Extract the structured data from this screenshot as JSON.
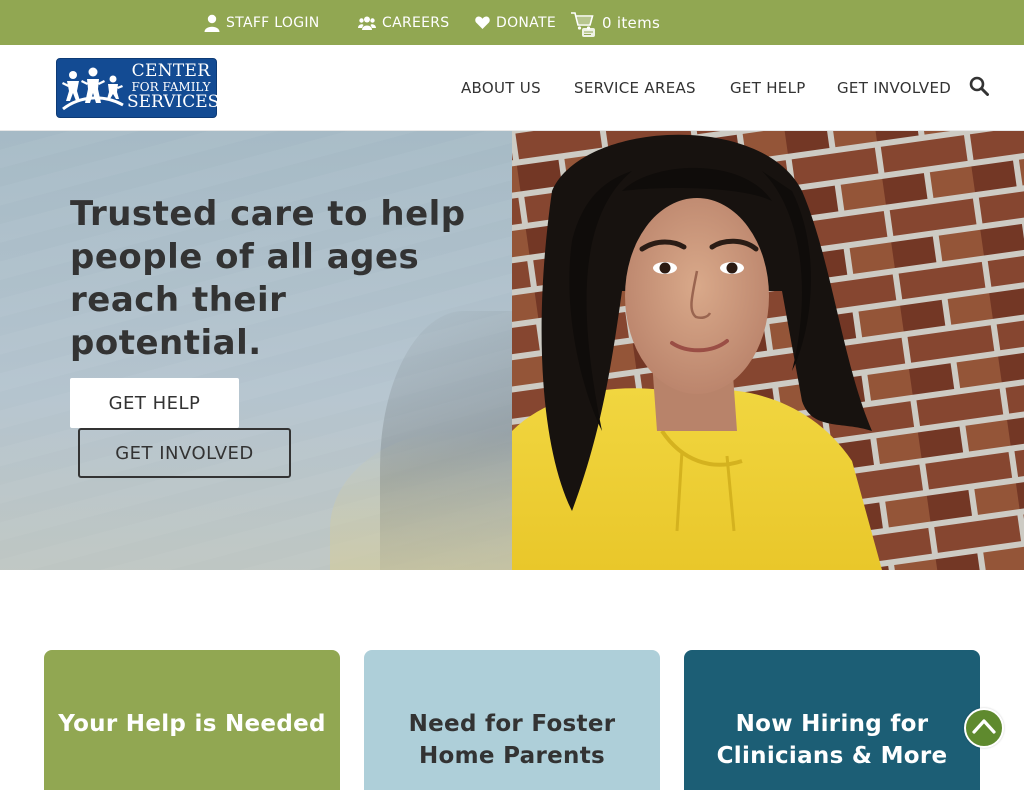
{
  "topbar": {
    "staff_login": "STAFF LOGIN",
    "careers": "CAREERS",
    "donate": "DONATE",
    "cart_items": "0 items",
    "icons": [
      "user-icon",
      "group-icon",
      "heart-icon",
      "cart-icon"
    ]
  },
  "logo": {
    "line1": "CENTER",
    "line2": "FOR FAMILY",
    "line3": "SERVICES"
  },
  "nav": {
    "items": [
      "ABOUT US",
      "SERVICE AREAS",
      "GET HELP",
      "GET INVOLVED"
    ],
    "search_icon": "search-icon"
  },
  "hero": {
    "title": "Trusted care to help people of all ages reach their potential.",
    "primary_button": "GET HELP",
    "secondary_button": "GET INVOLVED"
  },
  "cards": [
    {
      "title": "Your Help is Needed"
    },
    {
      "title": "Need for Foster Home Parents"
    },
    {
      "title": "Now Hiring for Clinicians & More"
    }
  ],
  "back_to_top_icon": "chevron-up-icon",
  "colors": {
    "brand_green": "#91a752",
    "logo_blue": "#134b93",
    "card_light_blue": "#aecfd9",
    "card_teal": "#1c5e75",
    "text_dark": "#333333"
  }
}
